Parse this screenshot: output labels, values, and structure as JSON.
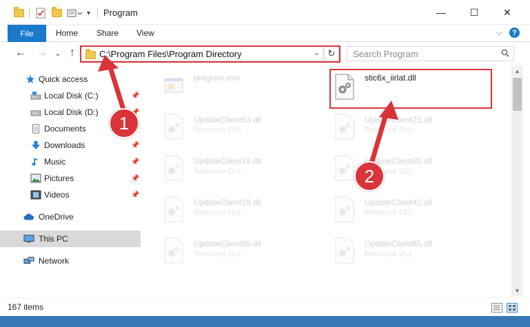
{
  "window": {
    "title": "Program",
    "minimize": "—",
    "maximize": "☐",
    "close": "✕"
  },
  "ribbon": {
    "file": "File",
    "home": "Home",
    "share": "Share",
    "view": "View",
    "expand": "⌵"
  },
  "nav": {
    "back": "←",
    "forward": "→",
    "recent": "⌄",
    "up": "↑"
  },
  "address": {
    "path": "C:\\Program Files\\Program Directory",
    "dropdown": "⌄",
    "refresh": "↻"
  },
  "search": {
    "placeholder": "Search Program"
  },
  "sidebar": {
    "items": [
      {
        "label": "Quick access",
        "icon": "star-icon",
        "pinned": false
      },
      {
        "label": "Local Disk (C:)",
        "icon": "drive-icon",
        "pinned": true
      },
      {
        "label": "Local Disk (D:)",
        "icon": "drive-icon",
        "pinned": true
      },
      {
        "label": "Documents",
        "icon": "document-icon",
        "pinned": true
      },
      {
        "label": "Downloads",
        "icon": "download-icon",
        "pinned": true
      },
      {
        "label": "Music",
        "icon": "music-icon",
        "pinned": true
      },
      {
        "label": "Pictures",
        "icon": "picture-icon",
        "pinned": true
      },
      {
        "label": "Videos",
        "icon": "video-icon",
        "pinned": true
      },
      {
        "label": "OneDrive",
        "icon": "cloud-icon",
        "pinned": false
      },
      {
        "label": "This PC",
        "icon": "computer-icon",
        "pinned": false,
        "selected": true
      },
      {
        "label": "Network",
        "icon": "network-icon",
        "pinned": false
      }
    ],
    "pin_glyph": "📌"
  },
  "files": [
    {
      "name": "program.exe",
      "sub": "",
      "faded": true,
      "icon": "exe-icon"
    },
    {
      "name": "stic6x_iirlat.dll",
      "sub": "",
      "faded": false,
      "icon": "dll-gear-icon"
    },
    {
      "name": "UpdateClient63.dll",
      "sub": "Resource DLL",
      "faded": true,
      "icon": "dll-gear-icon"
    },
    {
      "name": "UpdateClient21.dll",
      "sub": "Resource DLL",
      "faded": true,
      "icon": "dll-gear-icon"
    },
    {
      "name": "UpdateClient19.dll",
      "sub": "Resource DLL",
      "faded": true,
      "icon": "dll-gear-icon"
    },
    {
      "name": "UpdateClient65.dll",
      "sub": "Resource DLL",
      "faded": true,
      "icon": "dll-gear-icon"
    },
    {
      "name": "UpdateClient19.dll",
      "sub": "Resource DLL",
      "faded": true,
      "icon": "dll-gear-icon"
    },
    {
      "name": "UpdateClient42.dll",
      "sub": "Resource DLL",
      "faded": true,
      "icon": "dll-gear-icon"
    },
    {
      "name": "UpdateClient65.dll",
      "sub": "Resource DLL",
      "faded": true,
      "icon": "dll-gear-icon"
    },
    {
      "name": "UpdateClient65.dll",
      "sub": "Resource DLL",
      "faded": true,
      "icon": "dll-gear-icon"
    }
  ],
  "status": {
    "count": "167 items"
  },
  "annotations": {
    "step1": "1",
    "step2": "2",
    "color": "#d9343a"
  }
}
